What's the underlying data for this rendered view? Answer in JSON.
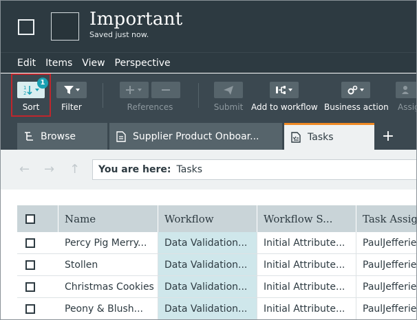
{
  "header": {
    "title": "Important",
    "subtitle": "Saved just now."
  },
  "menu": {
    "items": [
      "Edit",
      "Items",
      "View",
      "Perspective"
    ]
  },
  "toolbar": {
    "sort_label": "Sort",
    "sort_badge": "1",
    "filter_label": "Filter",
    "references_label": "References",
    "submit_label": "Submit",
    "add_to_workflow_label": "Add to workflow",
    "business_action_label": "Business action",
    "assign_label": "Assign"
  },
  "tabs": {
    "items": [
      {
        "label": "Browse"
      },
      {
        "label": "Supplier Product Onboar..."
      },
      {
        "label": "Tasks"
      }
    ],
    "add_symbol": "+"
  },
  "breadcrumb": {
    "prefix": "You are here:",
    "current": "Tasks"
  },
  "grid": {
    "columns": [
      "Name",
      "Workflow",
      "Workflow S...",
      "Task Assignee"
    ],
    "rows": [
      {
        "name": "Percy Pig Merry...",
        "workflow": "Data Validation...",
        "state": "Initial Attribute...",
        "assignee": "PaulJefferies"
      },
      {
        "name": "Stollen",
        "workflow": "Data Validation...",
        "state": "Initial Attribute...",
        "assignee": "PaulJefferies"
      },
      {
        "name": "Christmas Cookies",
        "workflow": "Data Validation...",
        "state": "Initial Attribute...",
        "assignee": "PaulJefferies"
      },
      {
        "name": "Peony & Blush...",
        "workflow": "Data Validation...",
        "state": "Initial Attribute...",
        "assignee": "PaulJefferies"
      }
    ]
  },
  "colors": {
    "header_bg": "#2d3a41",
    "toolbar_bg": "#3b4850",
    "active_tab_accent": "#f08a24",
    "sort_highlight": "#c0262c",
    "badge": "#1aa1b3",
    "workflow_column_bg": "#cfe7eb"
  },
  "icons": {
    "window": "checkbox-outline-icon",
    "sort": "sort-icon",
    "filter": "funnel-icon",
    "references_add": "plus-icon",
    "references_remove": "minus-icon",
    "submit": "paper-plane-icon",
    "add_to_workflow": "workflow-icon",
    "business_action": "gears-icon",
    "browse": "tree-icon",
    "document": "document-icon",
    "tasks": "tasks-icon",
    "back": "arrow-left-icon",
    "forward": "arrow-right-icon",
    "up": "arrow-up-icon"
  }
}
